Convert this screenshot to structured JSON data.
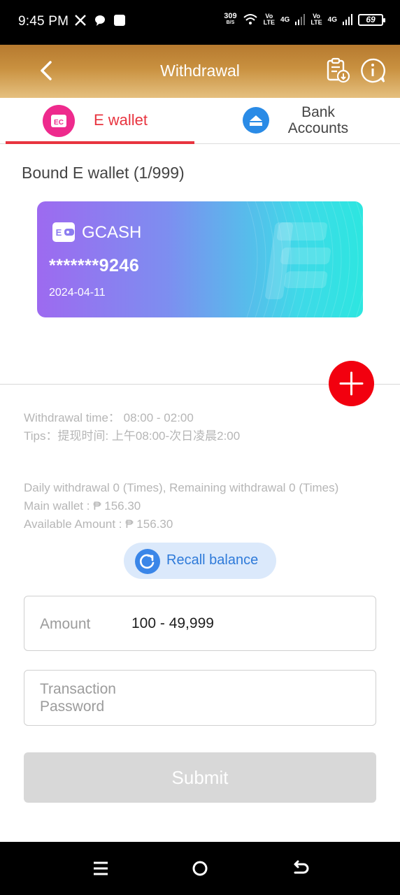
{
  "status_bar": {
    "time": "9:45 PM",
    "net_speed": "309",
    "net_speed_unit": "B/S",
    "vol1": "Vo",
    "lte1": "LTE",
    "gen1": "4G",
    "vol2": "Vo",
    "lte2": "LTE",
    "gen2": "4G",
    "battery": "69"
  },
  "header": {
    "title": "Withdrawal"
  },
  "tabs": [
    {
      "label": "E wallet",
      "active": true
    },
    {
      "label": "Bank Accounts",
      "active": false
    }
  ],
  "bound_title": "Bound E wallet (1/999)",
  "card": {
    "name": "GCASH",
    "number": "*******9246",
    "date": "2024-04-11"
  },
  "info": {
    "withdrawal_time": "Withdrawal time：  08:00 - 02:00",
    "tips": "Tips：提现时间: 上午08:00-次日凌晨2:00",
    "daily": "Daily withdrawal 0 (Times), Remaining withdrawal 0 (Times)",
    "main_wallet": "Main wallet : ₱ 156.30",
    "available": "Available Amount : ₱ 156.30"
  },
  "recall_label": "Recall balance",
  "amount": {
    "label": "Amount",
    "placeholder": "100 - 49,999"
  },
  "password": {
    "label": "Transaction Password"
  },
  "submit_label": "Submit",
  "colors": {
    "accent_red": "#e8343f",
    "header_gold": "#c99140",
    "add_button": "#f2000f",
    "recall_blue": "#2e7ad9"
  }
}
